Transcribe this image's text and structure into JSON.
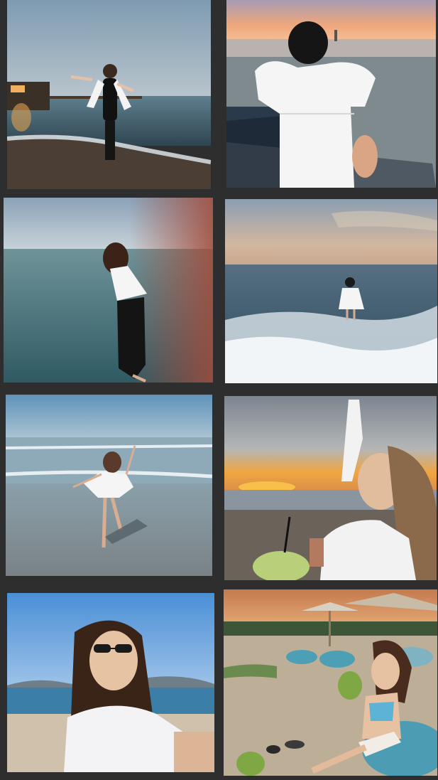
{
  "collage": {
    "background": "#2e2e2e",
    "photos": [
      {
        "id": 1,
        "alt_icon": "photo-icon",
        "palette": {
          "sky": "#8ea7b9",
          "sea": "#4a6a7a",
          "sand": "#5a4a3e"
        }
      },
      {
        "id": 2,
        "alt_icon": "photo-icon",
        "palette": {
          "sky": "#e59a6f",
          "sea": "#7a8a92",
          "shirt": "#f2f2f2"
        }
      },
      {
        "id": 3,
        "alt_icon": "photo-icon",
        "palette": {
          "sky": "#9db0c0",
          "sea": "#4e7b85",
          "warm": "#a25a4a"
        }
      },
      {
        "id": 4,
        "alt_icon": "photo-icon",
        "palette": {
          "sky": "#b9a99a",
          "sea": "#4b6f82",
          "foam": "#e8eef2"
        }
      },
      {
        "id": 5,
        "alt_icon": "photo-icon",
        "palette": {
          "sky": "#6e9cbf",
          "sea": "#8aa6b4",
          "sand": "#8e9aa0"
        }
      },
      {
        "id": 6,
        "alt_icon": "photo-icon",
        "palette": {
          "sky": "#9aa1a8",
          "sun": "#f0a23c",
          "sand": "#6f6860"
        }
      },
      {
        "id": 7,
        "alt_icon": "photo-icon",
        "palette": {
          "sky": "#5c97d6",
          "sea": "#3f7fa5",
          "sand": "#c8bba7"
        }
      },
      {
        "id": 8,
        "alt_icon": "photo-icon",
        "palette": {
          "sky": "#d98b57",
          "sand": "#b9aa96",
          "beanbag": "#4c9db3"
        }
      }
    ]
  }
}
